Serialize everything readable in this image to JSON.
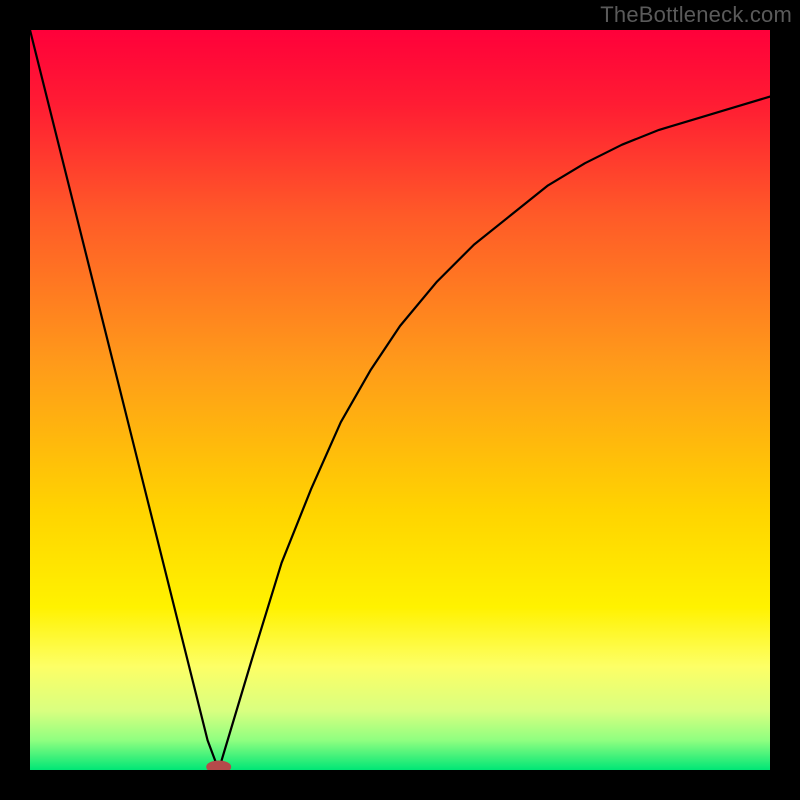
{
  "watermark": {
    "text": "TheBottleneck.com"
  },
  "chart_data": {
    "type": "line",
    "title": "",
    "xlabel": "",
    "ylabel": "",
    "xlim": [
      0,
      100
    ],
    "ylim": [
      0,
      100
    ],
    "grid": false,
    "legend": false,
    "background_gradient": {
      "direction": "vertical",
      "stops": [
        {
          "pos": 0.0,
          "color": "#ff003a"
        },
        {
          "pos": 0.1,
          "color": "#ff1c33"
        },
        {
          "pos": 0.25,
          "color": "#ff5a28"
        },
        {
          "pos": 0.45,
          "color": "#ff9a1a"
        },
        {
          "pos": 0.65,
          "color": "#ffd400"
        },
        {
          "pos": 0.78,
          "color": "#fff200"
        },
        {
          "pos": 0.86,
          "color": "#fdff66"
        },
        {
          "pos": 0.92,
          "color": "#d9ff80"
        },
        {
          "pos": 0.96,
          "color": "#8fff80"
        },
        {
          "pos": 1.0,
          "color": "#00e676"
        }
      ]
    },
    "series": [
      {
        "name": "bottleneck-curve",
        "x": [
          0,
          4,
          8,
          12,
          16,
          20,
          22,
          24,
          25.5,
          27,
          30,
          34,
          38,
          42,
          46,
          50,
          55,
          60,
          65,
          70,
          75,
          80,
          85,
          90,
          95,
          100
        ],
        "y": [
          100,
          84,
          68,
          52,
          36,
          20,
          12,
          4,
          0,
          5,
          15,
          28,
          38,
          47,
          54,
          60,
          66,
          71,
          75,
          79,
          82,
          84.5,
          86.5,
          88,
          89.5,
          91
        ]
      }
    ],
    "min_point": {
      "x": 25.5,
      "y": 0
    },
    "annotations": []
  }
}
